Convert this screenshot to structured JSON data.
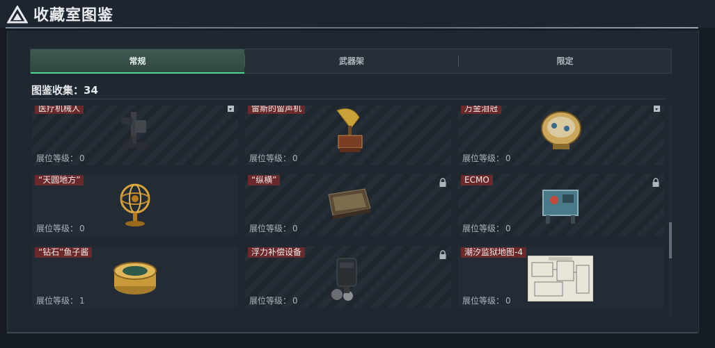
{
  "window": {
    "title": "收藏室图鉴",
    "icon": "triangle-logo-icon"
  },
  "tabs": [
    {
      "label": "常规",
      "active": true
    },
    {
      "label": "武器架",
      "active": false
    },
    {
      "label": "限定",
      "active": false
    }
  ],
  "collection": {
    "label": "图鉴收集：",
    "count": "34"
  },
  "level_label": "展位等级：",
  "items": [
    {
      "name": "医疗机械人",
      "level": "0",
      "state": "dropdown-icon"
    },
    {
      "name": "雷斯的留声机",
      "level": "0",
      "state": ""
    },
    {
      "name": "万金泪冠",
      "level": "0",
      "state": "dropdown-icon"
    },
    {
      "name": "“天圆地方”",
      "level": "0",
      "state": ""
    },
    {
      "name": "“纵横”",
      "level": "0",
      "state": "lock-icon"
    },
    {
      "name": "ECMO",
      "level": "0",
      "state": "lock-icon"
    },
    {
      "name": "“钻石”鱼子酱",
      "level": "1",
      "state": ""
    },
    {
      "name": "浮力补偿设备",
      "level": "0",
      "state": "lock-icon"
    },
    {
      "name": "潮汐监狱地图-4",
      "level": "0",
      "state": ""
    }
  ],
  "colors": {
    "active_tab_accent": "#4fd69a",
    "tag_bg": "#6a2a2c",
    "panel_bg": "#1f2831"
  }
}
